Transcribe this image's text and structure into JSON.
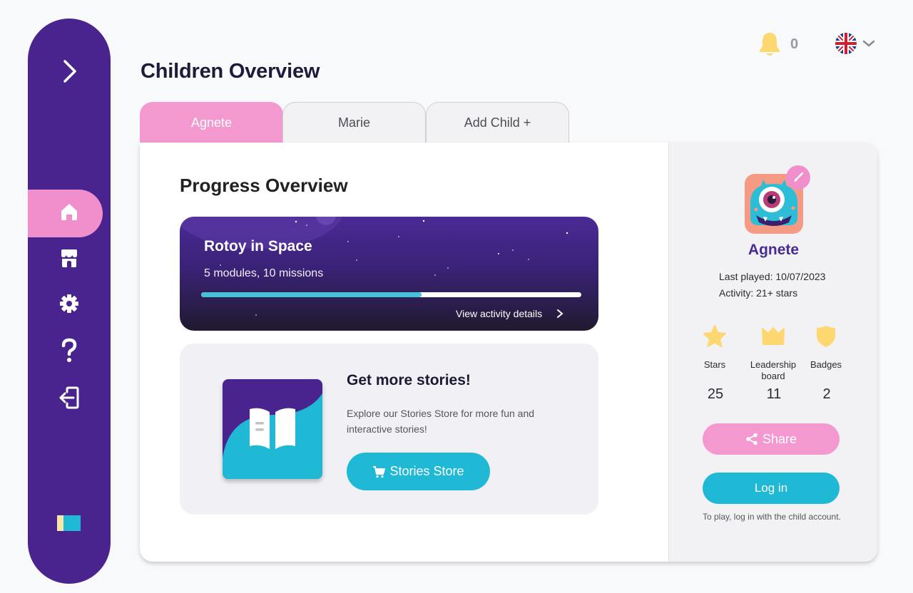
{
  "header": {
    "title": "Children Overview",
    "notification_count": "0",
    "language": "English (UK)"
  },
  "tabs": [
    {
      "label": "Agnete",
      "active": true
    },
    {
      "label": "Marie",
      "active": false
    },
    {
      "label": "Add Child +",
      "active": false
    }
  ],
  "progress": {
    "section_title": "Progress Overview",
    "course": {
      "title": "Rotoy in Space",
      "subtitle": "5 modules, 10 missions",
      "progress_percent": 58,
      "link_label": "View activity details"
    },
    "promo": {
      "title": "Get more stories!",
      "text": "Explore our Stories Store for more fun and interactive stories!",
      "button_label": "Stories Store"
    }
  },
  "child": {
    "name": "Agnete",
    "last_played": "Last played: 10/07/2023",
    "activity": "Activity: 21+ stars",
    "stats": [
      {
        "icon": "star-icon",
        "label": "Stars",
        "value": "25"
      },
      {
        "icon": "crown-icon",
        "label": "Leadership board",
        "value": "11"
      },
      {
        "icon": "shield-icon",
        "label": "Badges",
        "value": "2"
      }
    ],
    "share_label": "Share",
    "login_label": "Log in",
    "login_hint": "To play, log in with the child account."
  },
  "colors": {
    "sidebar": "#4a248e",
    "pink": "#f399d0",
    "cyan": "#1fb9d6",
    "star": "#fdd870"
  }
}
